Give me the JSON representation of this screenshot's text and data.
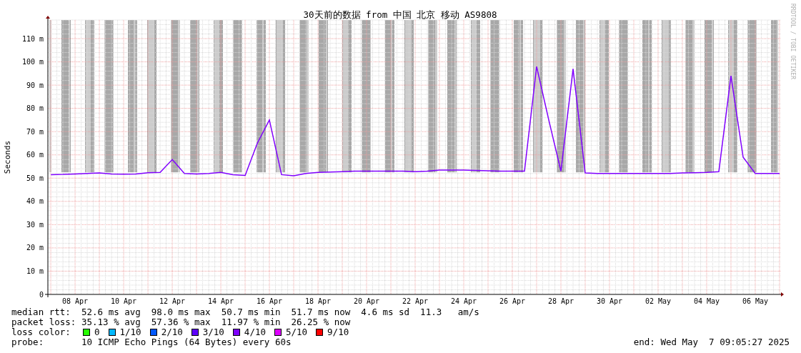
{
  "chart": {
    "chart_data": {
      "type": "line",
      "title": "30天前的数据 from 中国 北京 移动 AS9808",
      "ylabel": "Seconds",
      "categories": [
        null,
        null,
        "08 Apr",
        null,
        null,
        null,
        "10 Apr",
        null,
        null,
        null,
        "12 Apr",
        null,
        null,
        null,
        "14 Apr",
        null,
        null,
        null,
        "16 Apr",
        null,
        null,
        null,
        "18 Apr",
        null,
        null,
        null,
        "20 Apr",
        null,
        null,
        null,
        "22 Apr",
        null,
        null,
        null,
        "24 Apr",
        null,
        null,
        null,
        "26 Apr",
        null,
        null,
        null,
        "28 Apr",
        null,
        null,
        null,
        "30 Apr",
        null,
        null,
        null,
        "02 May",
        null,
        null,
        null,
        "04 May",
        null,
        null,
        null,
        "06 May",
        null,
        null
      ],
      "series": [
        {
          "color": "#8000ff",
          "values": [
            51.5,
            51.6,
            51.8,
            52,
            52.2,
            51.8,
            51.7,
            51.8,
            52.3,
            52.5,
            58,
            52,
            51.8,
            52,
            52.5,
            51.5,
            51.2,
            65,
            75,
            51.5,
            51,
            52,
            52.5,
            52.6,
            52.8,
            53,
            53,
            53,
            53,
            53,
            52.8,
            53,
            53.5,
            53.5,
            53.5,
            53.3,
            53.2,
            53,
            53,
            53,
            98,
            75,
            53,
            97,
            52.2,
            52,
            52,
            52,
            52,
            52,
            52,
            52,
            52.2,
            52.3,
            52.5,
            52.8,
            94,
            59,
            52,
            52,
            52
          ]
        }
      ],
      "grid": true,
      "ylim": [
        0,
        118
      ],
      "yticks": [
        {
          "value": 0,
          "label": "0"
        },
        {
          "value": 10,
          "label": "10 m"
        },
        {
          "value": 20,
          "label": "20 m"
        },
        {
          "value": 30,
          "label": "30 m"
        },
        {
          "value": 40,
          "label": "40 m"
        },
        {
          "value": 50,
          "label": "50 m"
        },
        {
          "value": 60,
          "label": "60 m"
        },
        {
          "value": 70,
          "label": "70 m"
        },
        {
          "value": 80,
          "label": "80 m"
        },
        {
          "value": 90,
          "label": "90 m"
        },
        {
          "value": 100,
          "label": "100 m"
        },
        {
          "value": 110,
          "label": "110 m"
        }
      ]
    },
    "credit": "RRDTOOL / TOBI OETIKER"
  },
  "legend": {
    "stats": [
      {
        "label": "median rtt:",
        "text": "52.6 ms avg  98.0 ms max  50.7 ms min  51.7 ms now  4.6 ms sd  11.3   am/s"
      },
      {
        "label": "packet loss:",
        "text": "35.13 % avg  57.36 % max  11.97 % min  26.25 % now"
      }
    ],
    "loss_colors": {
      "label": "loss color:",
      "items": [
        {
          "label": "0",
          "color": "#26ff00"
        },
        {
          "label": "1/10",
          "color": "#00b8ff"
        },
        {
          "label": "2/10",
          "color": "#0059ff"
        },
        {
          "label": "3/10",
          "color": "#5e00ff"
        },
        {
          "label": "4/10",
          "color": "#7e00ff"
        },
        {
          "label": "5/10",
          "color": "#dd00ff"
        },
        {
          "label": "9/10",
          "color": "#ff0000"
        }
      ]
    },
    "probe": {
      "label": "probe:",
      "text": "10 ICMP Echo Pings (64 Bytes) every 60s"
    },
    "end": "end: Wed May  7 09:05:27 2025"
  }
}
